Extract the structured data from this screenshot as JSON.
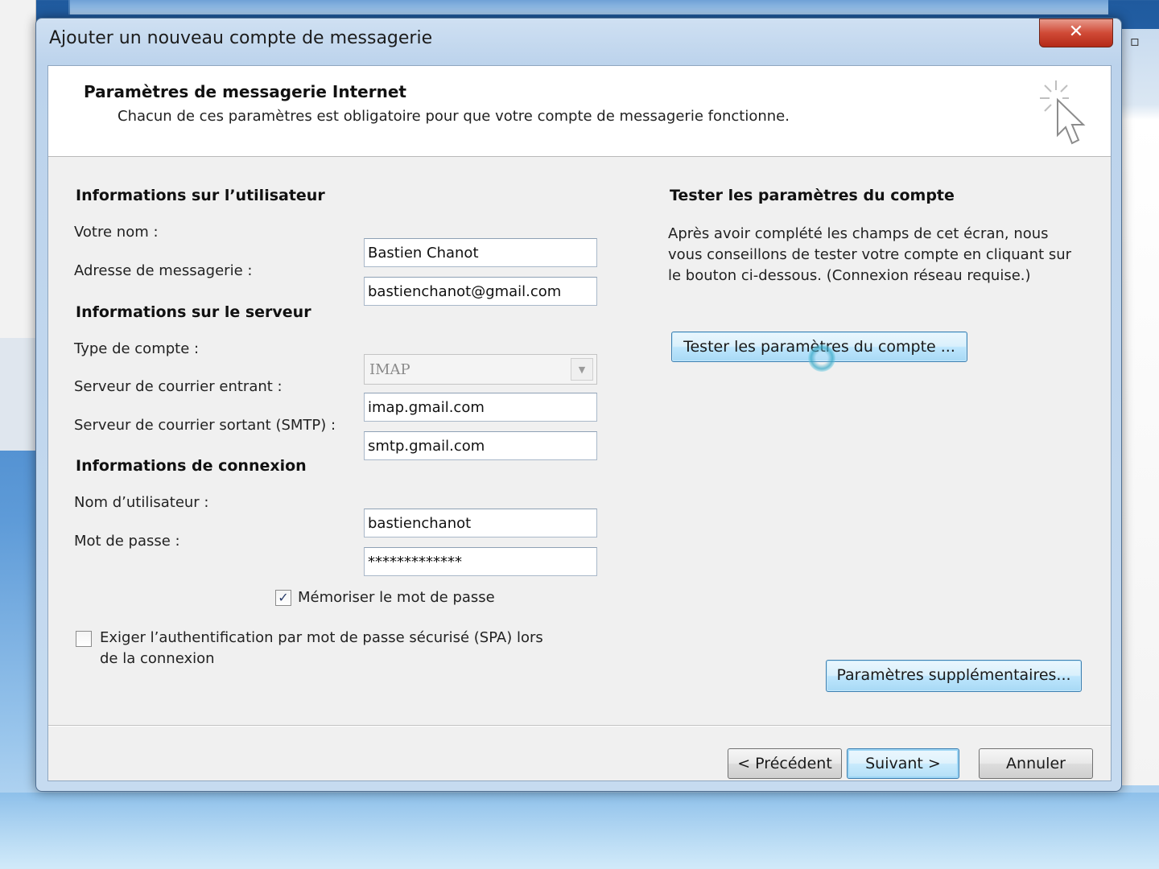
{
  "dialog": {
    "title": "Ajouter un nouveau compte de messagerie",
    "close_label": "✕"
  },
  "header": {
    "title": "Paramètres de messagerie Internet",
    "subtitle": "Chacun de ces paramètres est obligatoire pour que votre compte de messagerie fonctionne."
  },
  "user_info": {
    "section_title": "Informations sur l’utilisateur",
    "name_label": "Votre nom :",
    "name_value": "Bastien Chanot",
    "email_label": "Adresse de messagerie :",
    "email_value": "bastienchanot@gmail.com"
  },
  "server_info": {
    "section_title": "Informations sur le serveur",
    "account_type_label": "Type de compte :",
    "account_type_value": "IMAP",
    "incoming_label": "Serveur de courrier entrant :",
    "incoming_value": "imap.gmail.com",
    "outgoing_label": "Serveur de courrier sortant (SMTP) :",
    "outgoing_value": "smtp.gmail.com"
  },
  "login_info": {
    "section_title": "Informations de connexion",
    "username_label": "Nom d’utilisateur :",
    "username_value": "bastienchanot",
    "password_label": "Mot de passe :",
    "password_value": "*************",
    "remember_label": "Mémoriser le mot de passe",
    "remember_checked": true,
    "spa_label_line1": "Exiger l’authentification par mot de passe sécurisé (SPA) lors",
    "spa_label_line2": "de la connexion",
    "spa_checked": false
  },
  "test_settings": {
    "section_title": "Tester les paramètres du compte",
    "line1": "Après avoir complété les champs de cet écran, nous",
    "line2": "vous conseillons de tester votre compte en cliquant sur",
    "line3": "le bouton ci-dessous. (Connexion réseau requise.)",
    "button_label": "Tester les paramètres du compte ..."
  },
  "more_settings_label": "Paramètres supplémentaires...",
  "footer": {
    "back_label": "< Précédent",
    "next_label": "Suivant >",
    "cancel_label": "Annuler"
  },
  "icons": [
    "close-icon",
    "wizard-cursor-icon",
    "chevron-down-icon",
    "checkmark-icon",
    "busy-cursor-icon"
  ]
}
